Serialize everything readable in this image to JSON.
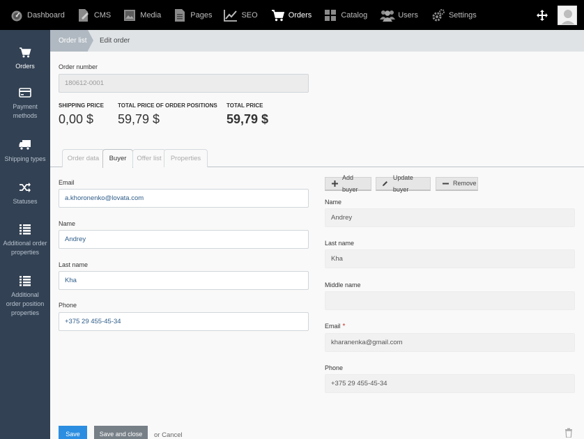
{
  "topnav": {
    "items": [
      {
        "label": "Dashboard",
        "icon": "dashboard-icon"
      },
      {
        "label": "CMS",
        "icon": "cms-icon"
      },
      {
        "label": "Media",
        "icon": "media-icon"
      },
      {
        "label": "Pages",
        "icon": "pages-icon"
      },
      {
        "label": "SEO",
        "icon": "seo-chart-icon"
      },
      {
        "label": "Orders",
        "icon": "cart-icon",
        "active": true
      },
      {
        "label": "Catalog",
        "icon": "catalog-icon"
      },
      {
        "label": "Users",
        "icon": "users-icon"
      },
      {
        "label": "Settings",
        "icon": "settings-gear-icon"
      }
    ]
  },
  "sidebar": {
    "items": [
      {
        "label": "Orders",
        "icon": "cart-icon",
        "active": true
      },
      {
        "label": "Payment methods",
        "icon": "credit-card-icon"
      },
      {
        "label": "Shipping types",
        "icon": "truck-icon"
      },
      {
        "label": "Statuses",
        "icon": "shuffle-icon"
      },
      {
        "label": "Additional order properties",
        "icon": "list-icon"
      },
      {
        "label": "Additional order position properties",
        "icon": "list-icon"
      }
    ]
  },
  "breadcrumb": {
    "parent": "Order list",
    "current": "Edit order"
  },
  "order": {
    "number_label": "Order number",
    "number_value": "180612-0001",
    "shipping_price_label": "SHIPPING PRICE",
    "shipping_price_value": "0,00 $",
    "positions_price_label": "TOTAL PRICE OF ORDER POSITIONS",
    "positions_price_value": "59,79 $",
    "total_price_label": "TOTAL PRICE",
    "total_price_value": "59,79 $"
  },
  "tabs": [
    {
      "label": "Order data"
    },
    {
      "label": "Buyer",
      "active": true
    },
    {
      "label": "Offer list"
    },
    {
      "label": "Properties"
    }
  ],
  "buyer_form": {
    "email_label": "Email",
    "email_value": "a.khoronenko@lovata.com",
    "name_label": "Name",
    "name_value": "Andrey",
    "last_name_label": "Last name",
    "last_name_value": "Kha",
    "phone_label": "Phone",
    "phone_value": "+375 29 455-45-34"
  },
  "buyer_panel": {
    "add_label": "Add buyer",
    "update_label": "Update buyer",
    "remove_label": "Remove",
    "name_label": "Name",
    "name_value": "Andrey",
    "last_name_label": "Last name",
    "last_name_value": "Kha",
    "middle_name_label": "Middle name",
    "middle_name_value": "",
    "email_label": "Email",
    "email_required": "*",
    "email_value": "kharanenka@gmail.com",
    "phone_label": "Phone",
    "phone_value": "+375 29 455-45-34"
  },
  "footer": {
    "save_label": "Save",
    "save_close_label": "Save and close",
    "or_label": "or",
    "cancel_label": "Cancel"
  },
  "colors": {
    "topbar": "#000000",
    "sidebar": "#324153",
    "primary": "#2c8ee0",
    "secondary": "#777f87"
  }
}
